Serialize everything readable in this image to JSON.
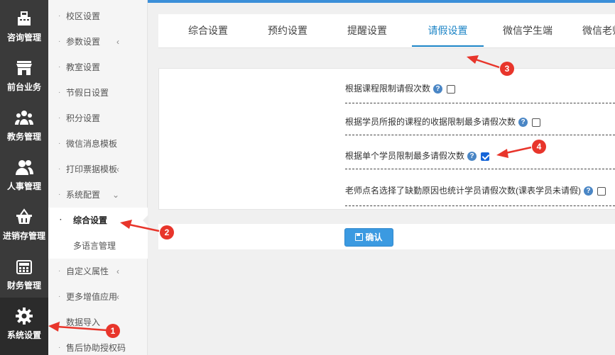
{
  "rail": [
    {
      "label": "咨询管理",
      "icon": "register-icon"
    },
    {
      "label": "前台业务",
      "icon": "storefront-icon"
    },
    {
      "label": "教务管理",
      "icon": "group-icon"
    },
    {
      "label": "人事管理",
      "icon": "people-icon"
    },
    {
      "label": "进销存管理",
      "icon": "basket-icon"
    },
    {
      "label": "财务管理",
      "icon": "calculator-icon"
    },
    {
      "label": "系统设置",
      "icon": "gear-icon"
    }
  ],
  "submenu": {
    "items": [
      {
        "label": "校区设置"
      },
      {
        "label": "参数设置"
      },
      {
        "label": "教室设置"
      },
      {
        "label": "节假日设置"
      },
      {
        "label": "积分设置"
      },
      {
        "label": "微信消息模板"
      },
      {
        "label": "打印票据模板"
      },
      {
        "label": "系统配置"
      },
      {
        "label": "综合设置"
      },
      {
        "label": "多语言管理"
      },
      {
        "label": "自定义属性"
      },
      {
        "label": "更多增值应用"
      },
      {
        "label": "数据导入"
      },
      {
        "label": "售后协助授权码"
      }
    ]
  },
  "tabs": [
    {
      "label": "综合设置"
    },
    {
      "label": "预约设置"
    },
    {
      "label": "提醒设置"
    },
    {
      "label": "请假设置"
    },
    {
      "label": "微信学生端"
    },
    {
      "label": "微信老师"
    }
  ],
  "options": [
    {
      "label": "根据课程限制请假次数",
      "checked": false
    },
    {
      "label": "根据学员所报的课程的收据限制最多请假次数",
      "checked": false
    },
    {
      "label": "根据单个学员限制最多请假次数",
      "checked": true
    },
    {
      "label": "老师点名选择了缺勤原因也统计学员请假次数(课表学员未请假)",
      "checked": false
    }
  ],
  "help_glyph": "?",
  "confirm_label": "确认",
  "badges": [
    "1",
    "2",
    "3",
    "4"
  ],
  "colors": {
    "accent": "#1c84c6",
    "annotation": "#e8352b",
    "rail": "#3a3a3a"
  }
}
